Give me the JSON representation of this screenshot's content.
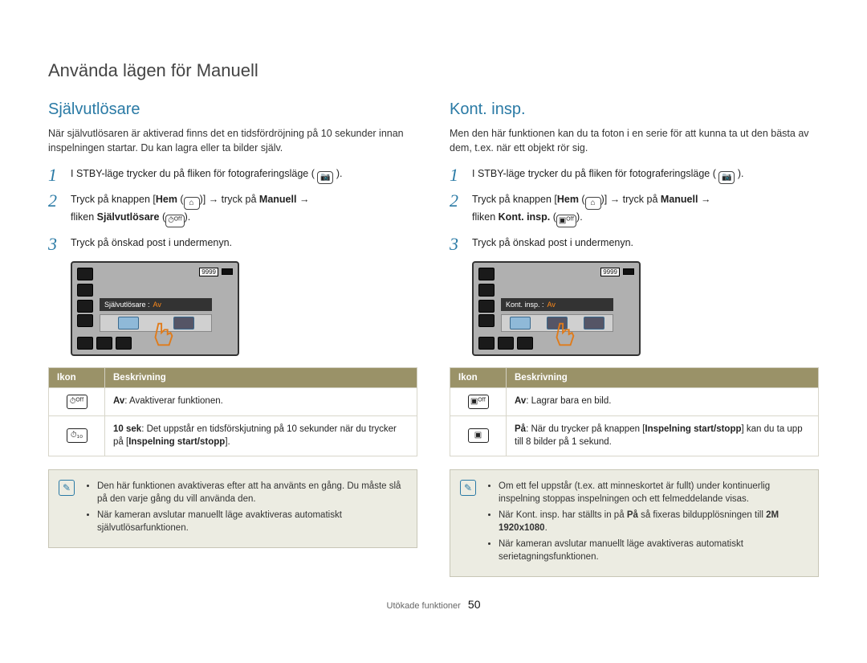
{
  "page_title": "Använda lägen för Manuell",
  "footer": {
    "section": "Utökade funktioner",
    "page": "50"
  },
  "icons": {
    "camera": "📷",
    "home": "⌂",
    "timer_off": "⏱ᴼᶠᶠ",
    "burst_off": "▣ᴼᶠᶠ"
  },
  "left": {
    "title": "Självutlösare",
    "intro": "När självutlösaren är aktiverad finns det en tidsfördröjning på 10 sekunder innan inspelningen startar. Du kan lagra eller ta bilder själv.",
    "steps": {
      "s1": "I STBY-läge trycker du på fliken för fotograferingsläge (",
      "s1_end": ").",
      "s2_a": "Tryck på knappen [",
      "s2_hem": "Hem",
      "s2_b": " (",
      "s2_c": ")] ",
      "s2_arrow": "→",
      "s2_d": " tryck på ",
      "s2_man": "Manuell",
      "s2_e": " ",
      "s2_f": "fliken ",
      "s2_tab": "Självutlösare",
      "s2_g": " (",
      "s2_h": ").",
      "s3": "Tryck på önskad post i undermenyn."
    },
    "shot": {
      "label": "Självutlösare : ",
      "value": "Av",
      "count": "9999"
    },
    "table": {
      "h1": "Ikon",
      "h2": "Beskrivning",
      "r1": {
        "bold": "Av",
        "rest": ": Avaktiverar funktionen."
      },
      "r2": {
        "bold": "10 sek",
        "rest": ": Det uppstår en tidsförskjutning på 10 sekunder när du trycker på [",
        "rec": "Inspelning start/stopp",
        "end": "]."
      }
    },
    "note": {
      "li1": "Den här funktionen avaktiveras efter att ha använts en gång. Du måste slå på den varje gång du vill använda den.",
      "li2": "När kameran avslutar manuellt läge avaktiveras automatiskt självutlösarfunktionen."
    }
  },
  "right": {
    "title": "Kont. insp.",
    "intro": "Men den här funktionen kan du ta foton i en serie för att kunna ta ut den bästa av dem, t.ex. när ett objekt rör sig.",
    "steps": {
      "s1": "I STBY-läge trycker du på fliken för fotograferingsläge (",
      "s1_end": ").",
      "s2_a": "Tryck på knappen [",
      "s2_hem": "Hem",
      "s2_b": " (",
      "s2_c": ")] ",
      "s2_arrow": "→",
      "s2_d": " tryck på ",
      "s2_man": "Manuell",
      "s2_e": " ",
      "s2_f": "fliken ",
      "s2_tab": "Kont. insp.",
      "s2_g": " (",
      "s2_h": ").",
      "s3": "Tryck på önskad post i undermenyn."
    },
    "shot": {
      "label": "Kont. insp. : ",
      "value": "Av",
      "count": "9999"
    },
    "table": {
      "h1": "Ikon",
      "h2": "Beskrivning",
      "r1": {
        "bold": "Av",
        "rest": ": Lagrar bara en bild."
      },
      "r2": {
        "bold": "På",
        "rest": ": När du trycker på knappen [",
        "rec": "Inspelning start/stopp",
        "end": "] kan du ta upp till 8 bilder på 1 sekund."
      }
    },
    "note": {
      "li1": "Om ett fel uppstår (t.ex. att minneskortet är fullt) under kontinuerlig inspelning stoppas inspelningen och ett felmeddelande visas.",
      "li2_a": "När Kont. insp. har ställts in på ",
      "li2_b": "På",
      "li2_c": " så fixeras bildupplösningen till ",
      "li2_d": "2M 1920x1080",
      "li2_e": ".",
      "li3": "När kameran avslutar manuellt läge avaktiveras automatiskt serietagningsfunktionen."
    }
  }
}
